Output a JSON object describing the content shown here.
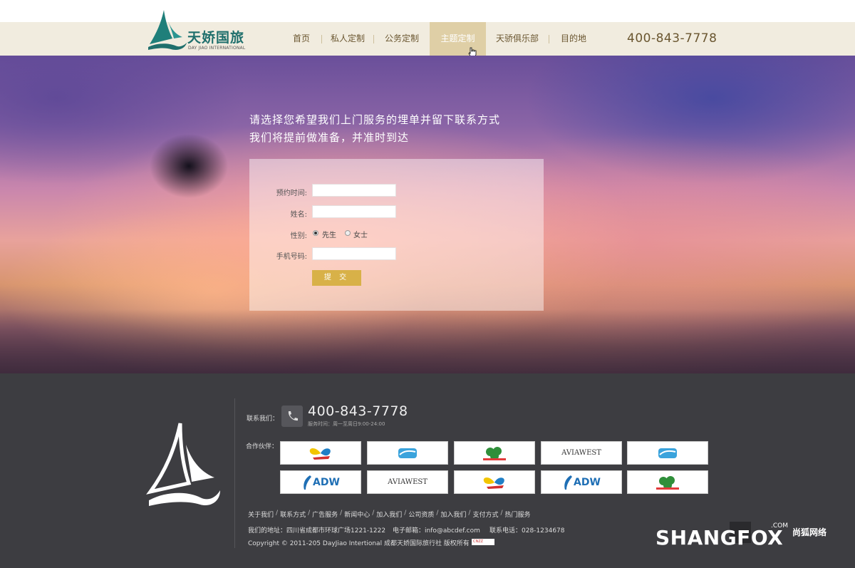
{
  "header": {
    "brand_cn": "天娇国旅",
    "brand_en": "DAY JIAO INTERNATIONAL",
    "nav": [
      {
        "label": "首页",
        "active": false
      },
      {
        "label": "私人定制",
        "active": false
      },
      {
        "label": "公务定制",
        "active": false
      },
      {
        "label": "主题定制",
        "active": true
      },
      {
        "label": "天骄俱乐部",
        "active": false
      },
      {
        "label": "目的地",
        "active": false
      }
    ],
    "phone": "400-843-7778"
  },
  "hero": {
    "line1": "请选择您希望我们上门服务的埋单并留下联系方式",
    "line2": "我们将提前做准备，并准时到达"
  },
  "form": {
    "time_label": "预约时间:",
    "time_value": "",
    "name_label": "姓名:",
    "name_value": "",
    "gender_label": "性别:",
    "gender_male": "先生",
    "gender_female": "女士",
    "gender_selected": "先生",
    "mobile_label": "手机号码:",
    "mobile_value": "",
    "submit_label": "提 交"
  },
  "footer": {
    "contact_label": "联系我们：",
    "phone": "400-843-7778",
    "hours": "服务时间：周一至周日9:00-24:00",
    "partners_label": "合作伙伴：",
    "partners": [
      {
        "name": "butterfly-logo",
        "text": ""
      },
      {
        "name": "blue-wave-logo",
        "text": ""
      },
      {
        "name": "green-clover-logo",
        "text": ""
      },
      {
        "name": "aviawest-logo",
        "text": "AVIAWEST"
      },
      {
        "name": "blue-wave-logo",
        "text": ""
      },
      {
        "name": "adw-logo",
        "text": "ADW"
      },
      {
        "name": "aviawest-logo",
        "text": "AVIAWEST"
      },
      {
        "name": "butterfly-logo",
        "text": ""
      },
      {
        "name": "adw-logo",
        "text": "ADW"
      },
      {
        "name": "green-clover-logo",
        "text": ""
      }
    ],
    "links": [
      "关于我们",
      "联系方式",
      "广告服务",
      "新闻中心",
      "加入我们",
      "公司资质",
      "加入我们",
      "支付方式",
      "热门服务"
    ],
    "address": "我们的地址：四川省成都市环球广场1221-1222",
    "email": "电子邮箱：info@abcdef.com",
    "tel": "联系电话：028-1234678",
    "copyright": "Copyright © 2011-205 DayJiao Intertional 成都天娇国际旅行社 版权所有",
    "cnzz": "CNZZ"
  },
  "watermark": {
    "main": "SHANGFOX",
    "com": ".COM",
    "cn": "尚狐网络"
  },
  "colors": {
    "header_bg": "#f1ecdf",
    "nav_active": "#dfcfa6",
    "nav_text": "#6a5630",
    "submit": "#d8b148",
    "footer_bg": "#3d3d41",
    "brand_teal": "#1f6f6c"
  }
}
